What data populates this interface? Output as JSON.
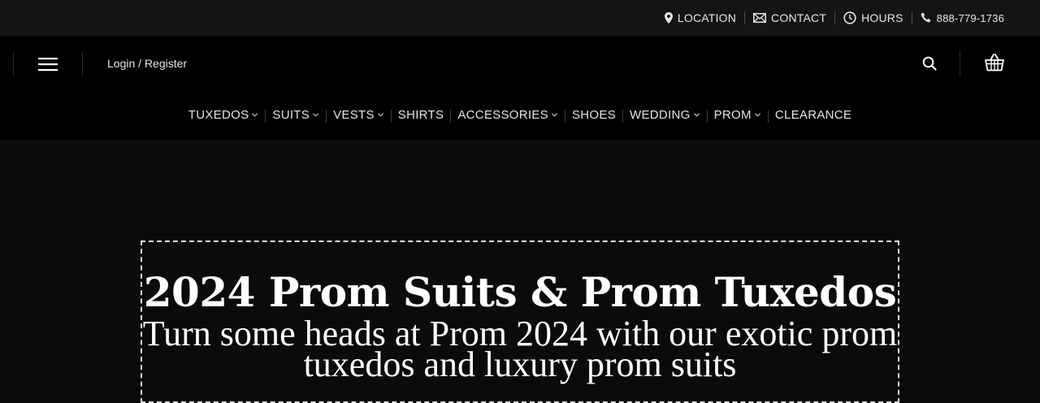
{
  "topbar": {
    "location": "LOCATION",
    "contact": "CONTACT",
    "hours": "HOURS",
    "phone": "888-779-1736"
  },
  "header": {
    "login_label": "Login / Register"
  },
  "nav": {
    "items": [
      {
        "label": "TUXEDOS",
        "dropdown": true
      },
      {
        "label": "SUITS",
        "dropdown": true
      },
      {
        "label": "VESTS",
        "dropdown": true
      },
      {
        "label": "SHIRTS",
        "dropdown": false
      },
      {
        "label": "ACCESSORIES",
        "dropdown": true
      },
      {
        "label": "SHOES",
        "dropdown": false
      },
      {
        "label": "WEDDING",
        "dropdown": true
      },
      {
        "label": "PROM",
        "dropdown": true
      },
      {
        "label": "CLEARANCE",
        "dropdown": false
      }
    ]
  },
  "hero": {
    "title": "2024 Prom Suits & Prom Tuxedos",
    "subtitle": "Turn some heads at Prom 2024 with our exotic prom tuxedos and luxury prom suits"
  },
  "colors": {
    "topbar_bg": "#141414",
    "header_bg": "#000000",
    "hero_bg": "#0b0b0b",
    "text": "#ffffff"
  },
  "icons": {
    "location": "map-pin-icon",
    "contact": "envelope-icon",
    "hours": "clock-icon",
    "phone": "phone-icon",
    "menu": "hamburger-menu-icon",
    "search": "search-icon",
    "cart": "basket-icon",
    "dropdown": "chevron-down-icon"
  }
}
